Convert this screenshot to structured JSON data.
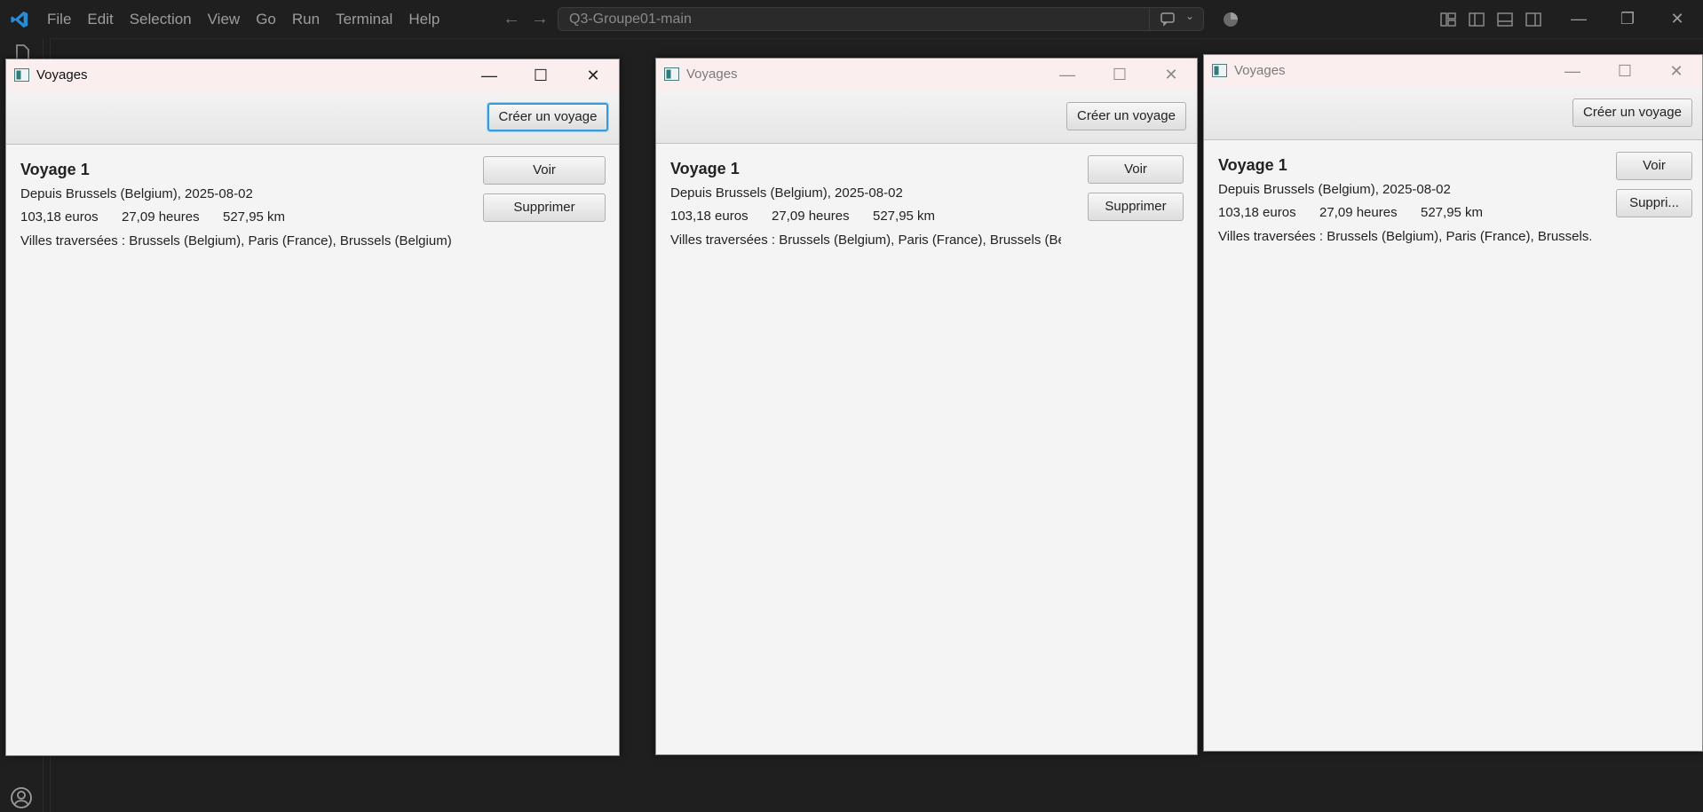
{
  "vscode": {
    "menu": [
      "File",
      "Edit",
      "Selection",
      "View",
      "Go",
      "Run",
      "Terminal",
      "Help"
    ],
    "search": "Q3-Groupe01-main"
  },
  "windows": [
    {
      "title": "Voyages",
      "create_button": "Créer un voyage",
      "voyage": {
        "name": "Voyage 1",
        "origin": "Depuis Brussels (Belgium), 2025-08-02",
        "cost": "103,18 euros",
        "duration": "27,09 heures",
        "distance": "527,95 km",
        "cities": "Villes traversées : Brussels (Belgium), Paris (France), Brussels (Belgium)"
      },
      "view_button": "Voir",
      "delete_button": "Supprimer"
    },
    {
      "title": "Voyages",
      "create_button": "Créer un voyage",
      "voyage": {
        "name": "Voyage 1",
        "origin": "Depuis Brussels (Belgium), 2025-08-02",
        "cost": "103,18 euros",
        "duration": "27,09 heures",
        "distance": "527,95 km",
        "cities": "Villes traversées : Brussels (Belgium), Paris (France), Brussels (Be..."
      },
      "view_button": "Voir",
      "delete_button": "Supprimer"
    },
    {
      "title": "Voyages",
      "create_button": "Créer un voyage",
      "voyage": {
        "name": "Voyage 1",
        "origin": "Depuis Brussels (Belgium), 2025-08-02",
        "cost": "103,18 euros",
        "duration": "27,09 heures",
        "distance": "527,95 km",
        "cities": "Villes traversées : Brussels (Belgium), Paris (France), Brussels..."
      },
      "view_button": "Voir",
      "delete_button": "Suppri..."
    }
  ]
}
